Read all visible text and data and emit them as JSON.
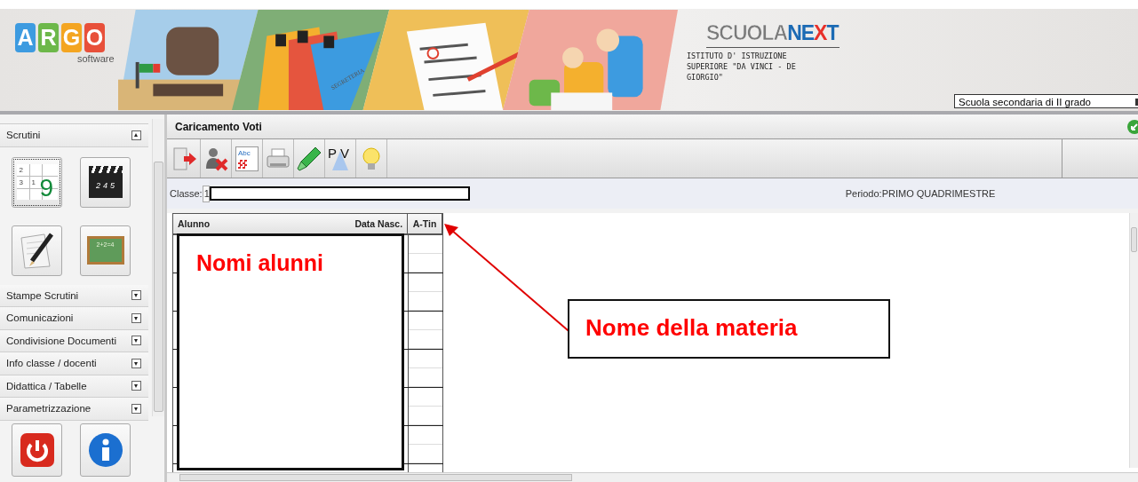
{
  "header": {
    "logo_letters": [
      {
        "text": "A",
        "color": "#3d9be0"
      },
      {
        "text": "R",
        "color": "#6db84a"
      },
      {
        "text": "G",
        "color": "#f4a521"
      },
      {
        "text": "O",
        "color": "#e8503a"
      }
    ],
    "logo_caption": "software",
    "folder_label": "SEGRETERIA",
    "product_logo": [
      {
        "text": "SCUOLA",
        "kind": "outline"
      },
      {
        "text": "NE",
        "kind": "blue"
      },
      {
        "text": "X",
        "kind": "red"
      },
      {
        "text": "T",
        "kind": "blue"
      }
    ],
    "school_name": "ISTITUTO D' ISTRUZIONE SUPERIORE \"DA VINCI - DE GIORGIO\"",
    "school_type": {
      "value": "Scuola secondaria di II grado"
    }
  },
  "sidebar": {
    "sections": [
      {
        "label": "Scrutini",
        "expanded": true,
        "tools": [
          {
            "kind": "grid",
            "texts": [
              "2",
              "3",
              "1",
              "9"
            ],
            "selected": true
          },
          {
            "kind": "clapper",
            "texts": [
              "2",
              "4",
              "5"
            ],
            "selected": false
          },
          {
            "kind": "pencil",
            "selected": false
          },
          {
            "kind": "chalkboard",
            "texts": [
              "2+2=4"
            ],
            "selected": false
          }
        ]
      },
      {
        "label": "Stampe Scrutini",
        "expanded": false
      },
      {
        "label": "Comunicazioni",
        "expanded": false
      },
      {
        "label": "Condivisione Documenti",
        "expanded": false
      },
      {
        "label": "Info classe / docenti",
        "expanded": false
      },
      {
        "label": "Didattica / Tabelle",
        "expanded": false
      },
      {
        "label": "Parametrizzazione",
        "expanded": false
      }
    ],
    "footer_buttons": [
      {
        "kind": "power"
      },
      {
        "kind": "info"
      }
    ]
  },
  "main": {
    "title": "Caricamento Voti",
    "toolbar": [
      {
        "kind": "exit"
      },
      {
        "kind": "remove_user"
      },
      {
        "kind": "spelling",
        "text": "Abc"
      },
      {
        "kind": "print"
      },
      {
        "kind": "highlighter"
      },
      {
        "kind": "pv",
        "text": "P V"
      },
      {
        "kind": "bulb"
      }
    ],
    "class_field": {
      "label": "Classe:",
      "value": "1"
    },
    "period": "Periodo:PRIMO QUADRIMESTRE",
    "table": {
      "columns": [
        "Alunno",
        "Data Nasc.",
        "A-Tin"
      ]
    },
    "annotations": [
      {
        "kind": "box",
        "text": "Nomi alunni"
      },
      {
        "kind": "callout",
        "text": "Nome della materia"
      }
    ]
  }
}
